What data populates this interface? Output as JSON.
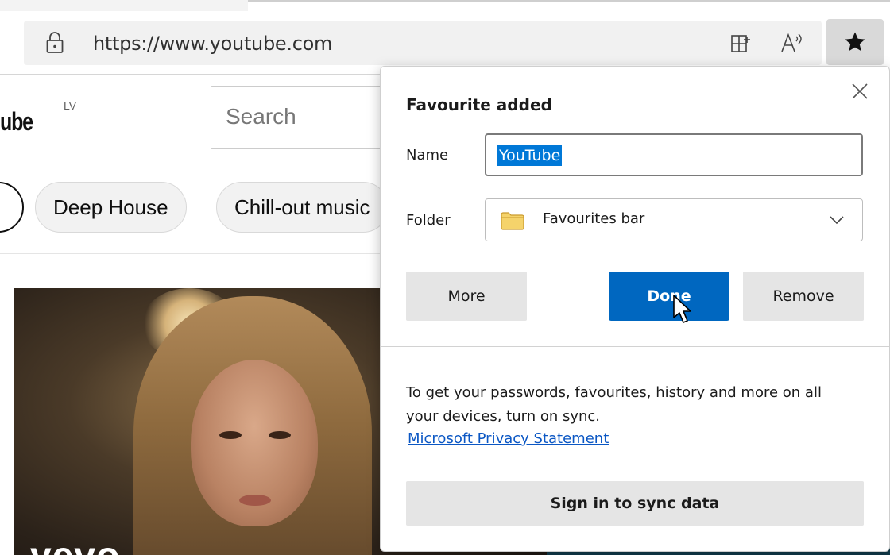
{
  "browser": {
    "url": "https://www.youtube.com"
  },
  "youtube": {
    "logo": "ube",
    "country": "LV",
    "search_placeholder": "Search",
    "chips": [
      "Deep House",
      "Chill-out music"
    ],
    "thumbnail_label": "vevo"
  },
  "popup": {
    "title": "Favourite added",
    "name_label": "Name",
    "name_value": "YouTube",
    "folder_label": "Folder",
    "folder_value": "Favourites bar",
    "more_label": "More",
    "done_label": "Done",
    "remove_label": "Remove",
    "sync_text": "To get your passwords, favourites, history and more on all your devices, turn on sync.",
    "privacy_link": "Microsoft Privacy Statement",
    "sync_button": "Sign in to sync data"
  },
  "colors": {
    "accent": "#0067c0",
    "selection": "#0078d7",
    "link": "#0b57c4"
  },
  "icons": {
    "lock": "lock-icon",
    "split_screen": "split-screen-icon",
    "read_aloud": "read-aloud-icon",
    "favourite": "star-filled-icon",
    "close": "close-icon",
    "folder": "folder-icon",
    "chevron": "chevron-down-icon",
    "cursor": "mouse-pointer-icon"
  }
}
